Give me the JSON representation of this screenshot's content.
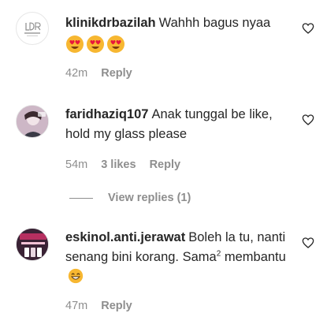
{
  "comments": [
    {
      "username": "klinikdrbazilah",
      "text": "Wahhh bagus nyaa",
      "emoji_count_label": "😍😍😍",
      "time": "42m",
      "likes": "",
      "reply": "Reply",
      "avatar_text": "DR BAZILAH"
    },
    {
      "username": "faridhaziq107",
      "text": "Anak tunggal be like, hold my glass please",
      "time": "54m",
      "likes": "3 likes",
      "reply": "Reply"
    },
    {
      "username": "eskinol.anti.jerawat",
      "text_part1": "Boleh la tu, nanti senang bini korang. Sama",
      "text_sup": "2",
      "text_part2": " membantu",
      "time": "47m",
      "likes": "",
      "reply": "Reply"
    }
  ],
  "view_replies": "View replies (1)",
  "colors": {
    "text": "#262626",
    "muted": "#8e8e8e",
    "emoji": "#f7b731"
  },
  "icons": {
    "like": "heart-outline-icon"
  }
}
